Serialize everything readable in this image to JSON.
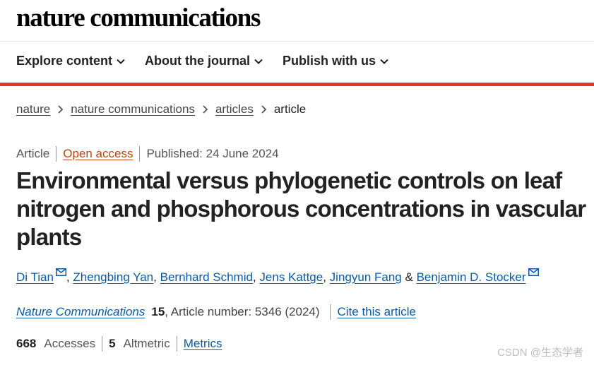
{
  "brand": "nature communications",
  "nav": [
    {
      "label": "Explore content"
    },
    {
      "label": "About the journal"
    },
    {
      "label": "Publish with us"
    }
  ],
  "breadcrumb": [
    {
      "label": "nature"
    },
    {
      "label": "nature communications"
    },
    {
      "label": "articles"
    },
    {
      "label": "article"
    }
  ],
  "meta": {
    "type": "Article",
    "access": "Open access",
    "published": "Published: 24 June 2024"
  },
  "title": "Environmental versus phylogenetic controls on leaf nitrogen and phosphorous concentrations in vascular plants",
  "authors": {
    "names": [
      "Di Tian",
      "Zhengbing Yan",
      "Bernhard Schmid",
      "Jens Kattge",
      "Jingyun Fang",
      "Benjamin D. Stocker"
    ],
    "separator": ",",
    "and": "&"
  },
  "citation": {
    "journal": "Nature Communications",
    "volume": "15",
    "article_number": ", Article number: 5346 (2024)",
    "cite_label": "Cite this article"
  },
  "metrics": {
    "accesses_value": "668",
    "accesses_label": "Accesses",
    "altmetric_value": "5",
    "altmetric_label": "Altmetric",
    "metrics_label": "Metrics"
  },
  "watermark": "CSDN @生态学者",
  "colors": {
    "accent_red": "#e2352a",
    "link_blue": "#0a5aa8",
    "open_access": "#b44811"
  }
}
